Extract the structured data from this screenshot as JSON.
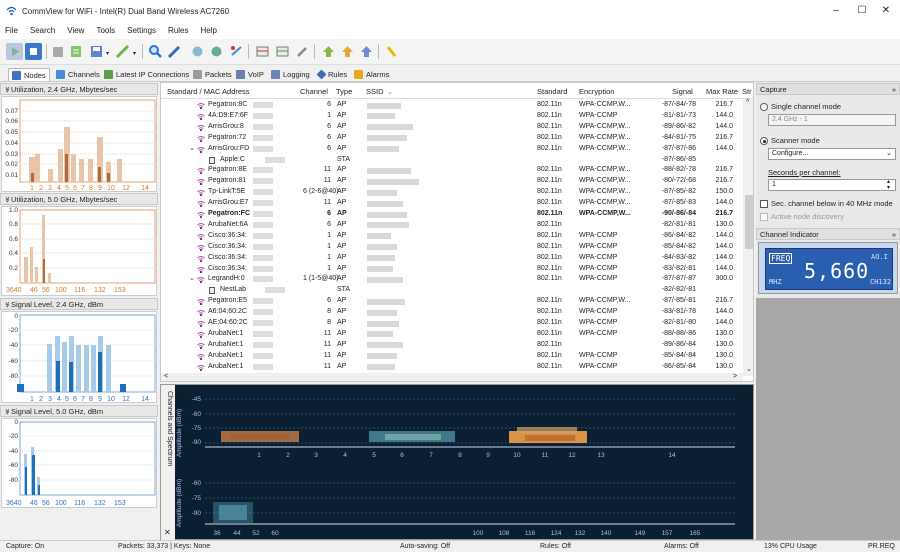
{
  "window": {
    "title": "CommView for WiFi - Intel(R) Dual Band Wireless AC7260",
    "minimize": "–",
    "maximize": "☐",
    "close": "✕"
  },
  "menu": [
    "File",
    "Search",
    "View",
    "Tools",
    "Settings",
    "Rules",
    "Help"
  ],
  "tabs": [
    "Nodes",
    "Channels",
    "Latest IP Connections",
    "Packets",
    "VoIP",
    "Logging",
    "Rules",
    "Alarms"
  ],
  "left_panels": {
    "util24": {
      "title": "Utilization, 2.4 GHz, Mbytes/sec",
      "yticks": [
        "0.07",
        "0.06",
        "0.05",
        "0.04",
        "0.03",
        "0.02",
        "0.01"
      ],
      "xticks": [
        "1",
        "2",
        "3",
        "4",
        "5",
        "6",
        "7",
        "8",
        "9",
        "10",
        "12",
        "14"
      ]
    },
    "util50": {
      "title": "Utilization, 5.0 GHz, Mbytes/sec",
      "yticks": [
        "1.0",
        "0.8",
        "0.6",
        "0.4",
        "0.2"
      ],
      "xticks": [
        "3640",
        "46",
        "56",
        "100",
        "116",
        "132",
        "153"
      ]
    },
    "sig24": {
      "title": "Signal Level, 2.4 GHz, dBm",
      "yticks": [
        "0",
        "-20",
        "-40",
        "-60",
        "-80"
      ],
      "xticks": [
        "1",
        "2",
        "3",
        "4",
        "5",
        "6",
        "7",
        "8",
        "9",
        "10",
        "12",
        "14"
      ]
    },
    "sig50": {
      "title": "Signal Level, 5.0 GHz, dBm",
      "yticks": [
        "0",
        "-20",
        "-40",
        "-60",
        "-80"
      ],
      "xticks": [
        "3640",
        "46",
        "56",
        "100",
        "116",
        "132",
        "153"
      ]
    }
  },
  "table": {
    "headers": {
      "mac": "Standard / MAC Address",
      "channel": "Channel",
      "type": "Type",
      "ssid": "SSID",
      "standard": "Standard",
      "encryption": "Encryption",
      "signal": "Signal",
      "maxrate": "Max Rate",
      "str": "Str"
    },
    "rows": [
      {
        "name": "Pegatron:8C",
        "ch": "6",
        "type": "AP",
        "std": "802.11n",
        "enc": "WPA-CCMP,W...",
        "sig": "-87/-84/-78",
        "rate": "216.7",
        "lvl": 1
      },
      {
        "name": "4A:D9:E7:6F",
        "ch": "1",
        "type": "AP",
        "std": "802.11n",
        "enc": "WPA-CCMP",
        "sig": "-81/-81/-73",
        "rate": "144.0",
        "lvl": 1
      },
      {
        "name": "ArrisGrou:8",
        "ch": "6",
        "type": "AP",
        "std": "802.11n",
        "enc": "WPA-CCMP,W...",
        "sig": "-89/-86/-82",
        "rate": "144.0",
        "lvl": 1
      },
      {
        "name": "Pegatron:72",
        "ch": "6",
        "type": "AP",
        "std": "802.11n",
        "enc": "WPA-CCMP,W...",
        "sig": "-84/-81/-75",
        "rate": "216.7",
        "lvl": 1
      },
      {
        "name": "ArrisGrou:FD",
        "ch": "6",
        "type": "AP",
        "std": "802.11n",
        "enc": "WPA-CCMP,W...",
        "sig": "-87/-87/-86",
        "rate": "144.0",
        "lvl": 1,
        "expanded": true
      },
      {
        "name": "Apple:C",
        "ch": "",
        "type": "STA",
        "std": "",
        "enc": "",
        "sig": "-87/-86/-85",
        "rate": "",
        "lvl": 2,
        "sta": true
      },
      {
        "name": "Pegatron:8E",
        "ch": "11",
        "type": "AP",
        "std": "802.11n",
        "enc": "WPA-CCMP,W...",
        "sig": "-88/-82/-78",
        "rate": "216.7",
        "lvl": 1
      },
      {
        "name": "Pegatron:81",
        "ch": "11",
        "type": "AP",
        "std": "802.11n",
        "enc": "WPA-CCMP,W...",
        "sig": "-80/-72/-68",
        "rate": "216.7",
        "lvl": 1
      },
      {
        "name": "Tp-LinkT:5E",
        "ch": "6 (2-6@40)",
        "type": "AP",
        "std": "802.11n",
        "enc": "WPA-CCMP,W...",
        "sig": "-87/-85/-82",
        "rate": "150.0",
        "lvl": 1
      },
      {
        "name": "ArrisGrou:E7",
        "ch": "11",
        "type": "AP",
        "std": "802.11n",
        "enc": "WPA-CCMP,W...",
        "sig": "-87/-85/-83",
        "rate": "144.0",
        "lvl": 1
      },
      {
        "name": "Pegatron:FC",
        "ch": "6",
        "type": "AP",
        "std": "802.11n",
        "enc": "WPA-CCMP,W...",
        "sig": "-90/-86/-84",
        "rate": "216.7",
        "lvl": 1,
        "bold": true
      },
      {
        "name": "ArubaNet:6A",
        "ch": "6",
        "type": "AP",
        "std": "802.11n",
        "enc": "",
        "sig": "-82/-81/-81",
        "rate": "130.0",
        "lvl": 1
      },
      {
        "name": "Cisco:36:34:",
        "ch": "1",
        "type": "AP",
        "std": "802.11n",
        "enc": "WPA-CCMP",
        "sig": "-86/-84/-82",
        "rate": "144.0",
        "lvl": 1
      },
      {
        "name": "Cisco:36:34:",
        "ch": "1",
        "type": "AP",
        "std": "802.11n",
        "enc": "WPA-CCMP",
        "sig": "-85/-84/-82",
        "rate": "144.0",
        "lvl": 1
      },
      {
        "name": "Cisco:36:34:",
        "ch": "1",
        "type": "AP",
        "std": "802.11n",
        "enc": "WPA-CCMP",
        "sig": "-84/-83/-82",
        "rate": "144.0",
        "lvl": 1
      },
      {
        "name": "Cisco:36:34:",
        "ch": "1",
        "type": "AP",
        "std": "802.11n",
        "enc": "WPA-CCMP",
        "sig": "-83/-82/-81",
        "rate": "144.0",
        "lvl": 1
      },
      {
        "name": "LegrandH:0",
        "ch": "1 (1-5@40)",
        "type": "AP",
        "std": "802.11n",
        "enc": "WPA-CCMP",
        "sig": "-87/-87/-87",
        "rate": "300.0",
        "lvl": 1,
        "expanded": true
      },
      {
        "name": "NestLab",
        "ch": "",
        "type": "STA",
        "std": "",
        "enc": "",
        "sig": "-82/-82/-81",
        "rate": "",
        "lvl": 2,
        "sta": true
      },
      {
        "name": "Pegatron:E5",
        "ch": "6",
        "type": "AP",
        "std": "802.11n",
        "enc": "WPA-CCMP,W...",
        "sig": "-87/-85/-81",
        "rate": "216.7",
        "lvl": 1
      },
      {
        "name": "A6:04:60:2C",
        "ch": "8",
        "type": "AP",
        "std": "802.11n",
        "enc": "WPA-CCMP",
        "sig": "-83/-81/-78",
        "rate": "144.0",
        "lvl": 1
      },
      {
        "name": "AE:04:60:2C",
        "ch": "8",
        "type": "AP",
        "std": "802.11n",
        "enc": "WPA-CCMP",
        "sig": "-82/-81/-80",
        "rate": "144.0",
        "lvl": 1
      },
      {
        "name": "ArubaNet:1",
        "ch": "11",
        "type": "AP",
        "std": "802.11n",
        "enc": "WPA-CCMP",
        "sig": "-88/-88/-86",
        "rate": "130.0",
        "lvl": 1
      },
      {
        "name": "ArubaNet:1",
        "ch": "11",
        "type": "AP",
        "std": "802.11n",
        "enc": "",
        "sig": "-89/-86/-84",
        "rate": "130.0",
        "lvl": 1
      },
      {
        "name": "ArubaNet:1",
        "ch": "11",
        "type": "AP",
        "std": "802.11n",
        "enc": "WPA-CCMP",
        "sig": "-85/-84/-84",
        "rate": "130.0",
        "lvl": 1
      },
      {
        "name": "ArubaNet:1",
        "ch": "11",
        "type": "AP",
        "std": "802.11n",
        "enc": "WPA-CCMP",
        "sig": "-86/-85/-84",
        "rate": "130.0",
        "lvl": 1
      }
    ]
  },
  "spectrum": {
    "side_label": "Channels and Spectrum",
    "close": "✕",
    "top": {
      "ylabel": "Amplitude (dBm)",
      "yticks": [
        "-45",
        "-60",
        "-75",
        "-90"
      ],
      "xticks": [
        "1",
        "2",
        "3",
        "4",
        "5",
        "6",
        "7",
        "8",
        "9",
        "10",
        "11",
        "12",
        "13",
        "14"
      ]
    },
    "bottom": {
      "ylabel": "Amplitude (dBm)",
      "yticks": [
        "-60",
        "-75",
        "-90"
      ],
      "xticks": [
        "36",
        "44",
        "52",
        "60",
        "100",
        "108",
        "116",
        "124",
        "132",
        "140",
        "149",
        "157",
        "165"
      ]
    }
  },
  "right": {
    "capture_title": "Capture",
    "single_channel": "Single channel mode",
    "channel_select": "2.4 GHz - 1",
    "scanner_mode": "Scanner mode",
    "configure": "Configure...",
    "seconds_label": "Seconds per channel:",
    "seconds_value": "1",
    "sec_channel": "Sec. channel below in 40 MHz mode",
    "active_discovery": "Active node discovery",
    "indicator_title": "Channel Indicator",
    "indicator": {
      "freq_label": "FREQ",
      "value": "5,660",
      "unit": "MHZ",
      "ao": "AO.I",
      "ch": "CH132"
    }
  },
  "status": {
    "capture": "Capture: On",
    "packets": "Packets: 33,373 | Keys: None",
    "autosave": "Auto-saving: Off",
    "rules": "Rules: Off",
    "alarms": "Alarms: Off",
    "cpu": "13% CPU Usage",
    "preq": "PR.REQ"
  }
}
